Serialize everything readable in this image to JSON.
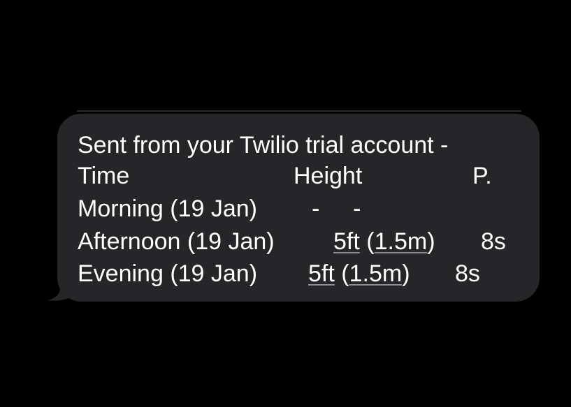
{
  "message": {
    "intro": "Sent from your Twilio trial account -",
    "header": {
      "time": "Time",
      "height": "Height",
      "period": "P."
    },
    "rows": [
      {
        "time": "Morning (19 Jan)",
        "height_a": "-",
        "height_b": "-"
      },
      {
        "time": "Afternoon (19 Jan)",
        "height_ft": "5ft",
        "paren_open": "(",
        "height_m": "1.5m",
        "paren_close": ")",
        "period": "8s"
      },
      {
        "time": "Evening (19 Jan)",
        "height_ft": "5ft",
        "paren_open": "(",
        "height_m": "1.5m",
        "paren_close": ")",
        "period": "8s"
      }
    ]
  },
  "colors": {
    "background": "#000000",
    "bubble": "#262628",
    "text": "#ffffff",
    "link_underline": "#8e8e93"
  }
}
